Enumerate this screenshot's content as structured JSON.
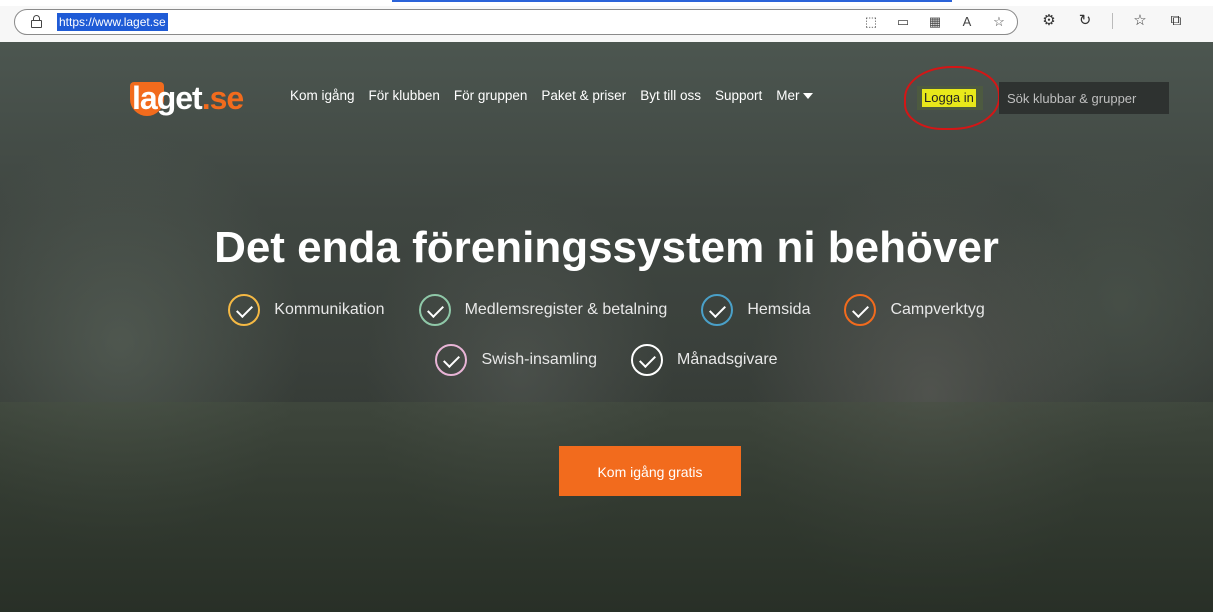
{
  "browser": {
    "url": "https://www.laget.se"
  },
  "header": {
    "logo_word": "laget",
    "logo_tld": ".se",
    "nav": [
      "Kom igång",
      "För klubben",
      "För gruppen",
      "Paket & priser",
      "Byt till oss",
      "Support"
    ],
    "more_label": "Mer",
    "login_label": "Logga in",
    "search_placeholder": "Sök klubbar & grupper"
  },
  "hero": {
    "headline": "Det enda föreningssystem ni behöver",
    "features_row1": [
      {
        "label": "Kommunikation",
        "color": "#f5b944"
      },
      {
        "label": "Medlemsregister & betalning",
        "color": "#8fc8a8"
      },
      {
        "label": "Hemsida",
        "color": "#4aa0c8"
      },
      {
        "label": "Campverktyg",
        "color": "#f26b1d"
      }
    ],
    "features_row2": [
      {
        "label": "Swish-insamling",
        "color": "#e8b4d6"
      },
      {
        "label": "Månadsgivare",
        "color": "#ffffff"
      }
    ],
    "cta_label": "Kom igång gratis"
  },
  "colors": {
    "brand": "#f26b1d",
    "login_highlight": "#e8e81a",
    "annotation": "#d41616"
  }
}
